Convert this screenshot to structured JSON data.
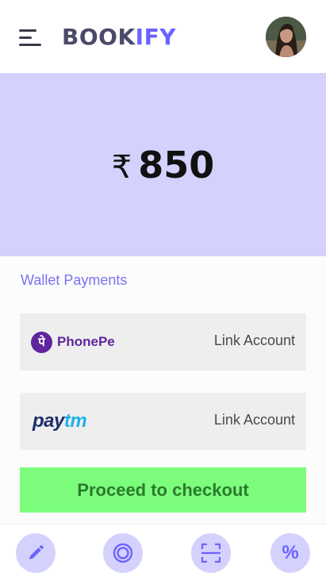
{
  "header": {
    "logo_part1": "BOOK",
    "logo_part2": "IFY"
  },
  "amount": {
    "currency_symbol": "₹",
    "value": "850"
  },
  "wallet": {
    "section_title": "Wallet Payments",
    "providers": [
      {
        "name": "PhonePe",
        "logo_glyph": "पे",
        "action": "Link Account"
      },
      {
        "name_part1": "pay",
        "name_part2": "tm",
        "action": "Link Account"
      }
    ]
  },
  "checkout": {
    "label": "Proceed to checkout"
  },
  "bottom_nav": {
    "items": [
      {
        "icon": "pencil-icon"
      },
      {
        "icon": "target-icon"
      },
      {
        "icon": "scan-icon"
      },
      {
        "icon": "percent-icon",
        "glyph": "%"
      }
    ]
  },
  "colors": {
    "accent": "#6c63ff",
    "banner": "#d4d2fd",
    "checkout_bg": "#7cfd7c",
    "checkout_text": "#2c7a2c",
    "phonepe": "#5f259f",
    "paytm_dark": "#1b2f6b",
    "paytm_light": "#20b0ea"
  }
}
